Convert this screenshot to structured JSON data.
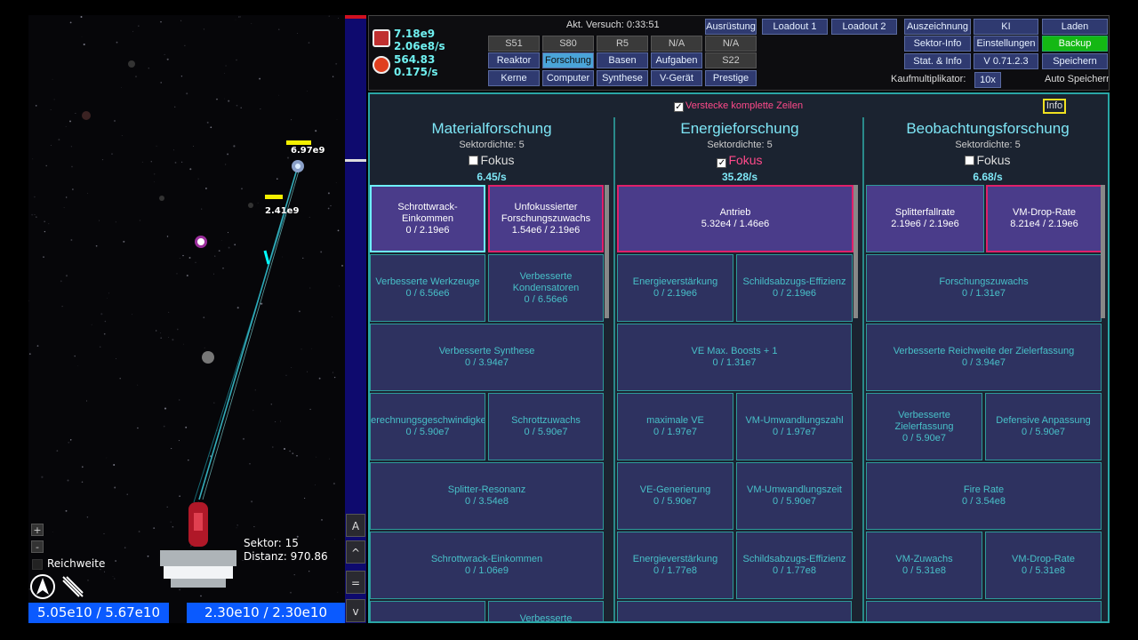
{
  "game": {
    "hp_labels": [
      "6.97e9",
      "2.41e9"
    ],
    "hp_fractions": [
      0.9,
      0.6
    ],
    "sector_label": "Sektor: 15",
    "distance_label": "Distanz: 970.86",
    "zoom_in": "+",
    "zoom_out": "-",
    "reach_label": "Reichweite",
    "bar_left": "5.05e10 / 5.67e10",
    "bar_right": "2.30e10 / 2.30e10"
  },
  "side_buttons": [
    "A",
    "^",
    "=",
    "v"
  ],
  "resources": {
    "r1_amount": "7.18e9",
    "r1_rate": "2.06e8/s",
    "r2_amount": "564.83",
    "r2_rate": "0.175/s"
  },
  "header": {
    "attempt_label": "Akt. Versuch: 0:33:51",
    "kauf_label": "Kaufmultiplikator:",
    "kauf_value": "10x",
    "auto_save": "Auto Speichern"
  },
  "grid_buttons": {
    "row1": [
      "S51",
      "S80",
      "R5",
      "N/A",
      "N/A"
    ],
    "row2": [
      "Reaktor",
      "Forschung",
      "Basen",
      "Aufgaben",
      "S22"
    ],
    "row3": [
      "Kerne",
      "Computer",
      "Synthese",
      "V-Gerät",
      "Prestige"
    ],
    "ausruestung": "Ausrüstung",
    "loadout1": "Loadout 1",
    "loadout2": "Loadout 2",
    "auszeichnung": "Auszeichnung",
    "ki": "KI",
    "laden": "Laden",
    "sektor_info": "Sektor-Info",
    "einstellungen": "Einstellungen",
    "backup": "Backup",
    "stat_info": "Stat. & Info",
    "version": "V 0.71.2.3",
    "speichern": "Speichern"
  },
  "panel": {
    "hide_rows": "Verstecke komplette Zeilen",
    "info": "Info",
    "columns": [
      {
        "title": "Materialforschung",
        "density": "Sektordichte: 5",
        "focus": "Fokus",
        "focus_checked": false,
        "rate": "6.45/s",
        "cards": [
          {
            "name": "Schrottwrack-Einkommen",
            "value": "0 / 2.19e6",
            "style": "lit cyan",
            "fill": 0
          },
          {
            "name": "Unfokussierter Forschungszuwachs",
            "value": "1.54e6 / 2.19e6",
            "style": "lit pink",
            "fill": 0.7
          },
          {
            "name": "Verbesserte Werkzeuge",
            "value": "0 / 6.56e6"
          },
          {
            "name": "Verbesserte Kondensatoren",
            "value": "0 / 6.56e6"
          },
          {
            "name": "Verbesserte Synthese",
            "value": "0 / 3.94e7"
          },
          {
            "name": "Berechnungsgeschwindigkeit",
            "value": "0 / 5.90e7"
          },
          {
            "name": "Schrottzuwachs",
            "value": "0 / 5.90e7"
          },
          {
            "name": "Splitter-Resonanz",
            "value": "0 / 3.54e8"
          },
          {
            "name": "Schrottwrack-Einkommen",
            "value": "0 / 1.06e9"
          },
          {
            "name": "",
            "value": ""
          },
          {
            "name": "Verbesserte",
            "value": ""
          }
        ]
      },
      {
        "title": "Energieforschung",
        "density": "Sektordichte: 5",
        "focus": "Fokus",
        "focus_checked": true,
        "rate": "35.28/s",
        "cards": [
          {
            "name": "Antrieb",
            "value": "5.32e4 / 1.46e6",
            "style": "lit pink",
            "fill": 0.036
          },
          {
            "name": "Energieverstärkung",
            "value": "0 / 2.19e6"
          },
          {
            "name": "Schildsabzugs-Effizienz",
            "value": "0 / 2.19e6"
          },
          {
            "name": "VE Max. Boosts + 1",
            "value": "0 / 1.31e7"
          },
          {
            "name": "maximale VE",
            "value": "0 / 1.97e7"
          },
          {
            "name": "VM-Umwandlungszahl",
            "value": "0 / 1.97e7"
          },
          {
            "name": "VE-Generierung",
            "value": "0 / 5.90e7"
          },
          {
            "name": "VM-Umwandlungszeit",
            "value": "0 / 5.90e7"
          },
          {
            "name": "Energieverstärkung",
            "value": "0 / 1.77e8"
          },
          {
            "name": "Schildsabzugs-Effizienz",
            "value": "0 / 1.77e8"
          },
          {
            "name": "",
            "value": ""
          }
        ]
      },
      {
        "title": "Beobachtungsforschung",
        "density": "Sektordichte: 5",
        "focus": "Fokus",
        "focus_checked": false,
        "rate": "6.68/s",
        "cards": [
          {
            "name": "Splitterfallrate",
            "value": "2.19e6 / 2.19e6",
            "style": "lit",
            "fill": 1
          },
          {
            "name": "VM-Drop-Rate",
            "value": "8.21e4 / 2.19e6",
            "style": "lit pink",
            "fill": 0.037
          },
          {
            "name": "Forschungszuwachs",
            "value": "0 / 1.31e7"
          },
          {
            "name": "Verbesserte Reichweite der Zielerfassung",
            "value": "0 / 3.94e7"
          },
          {
            "name": "Verbesserte Zielerfassung",
            "value": "0 / 5.90e7"
          },
          {
            "name": "Defensive Anpassung",
            "value": "0 / 5.90e7"
          },
          {
            "name": "Fire Rate",
            "value": "0 / 3.54e8"
          },
          {
            "name": "VM-Zuwachs",
            "value": "0 / 5.31e8"
          },
          {
            "name": "VM-Drop-Rate",
            "value": "0 / 5.31e8"
          },
          {
            "name": "",
            "value": ""
          }
        ]
      }
    ]
  },
  "colors": {
    "panel_border": "#2aa6a6",
    "card_bg": "#2e3260",
    "card_text": "#48c0c8",
    "title": "#7ee6f6",
    "pink": "#ff4a8a",
    "resource_bar": "#0a5aff"
  }
}
